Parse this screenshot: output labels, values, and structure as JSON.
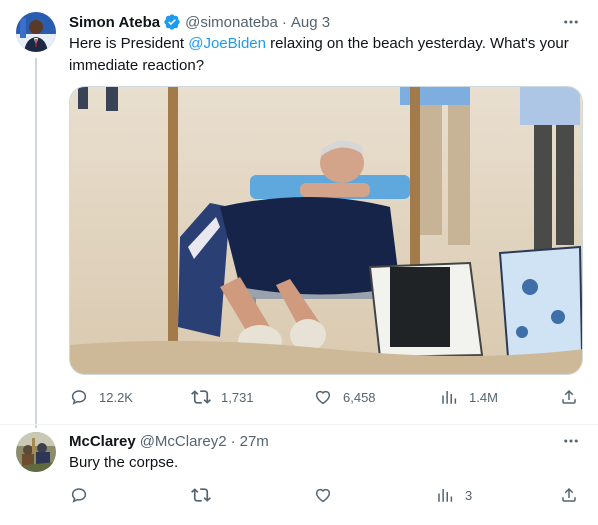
{
  "colors": {
    "accent": "#1d9bf0",
    "text": "#0f1419",
    "muted": "#536471",
    "thread_line": "#cfd9de"
  },
  "main_tweet": {
    "author_name": "Simon Ateba",
    "verified": true,
    "handle": "@simonateba",
    "separator": "·",
    "time": "Aug 3",
    "text_before_mention": "Here is President ",
    "mention": "@JoeBiden",
    "text_after_mention": " relaxing on the beach yesterday. What's your immediate reaction?",
    "has_media": true,
    "actions": {
      "reply_icon": "reply-icon",
      "reply_count": "12.2K",
      "retweet_icon": "retweet-icon",
      "retweet_count": "1,731",
      "like_icon": "like-icon",
      "like_count": "6,458",
      "views_icon": "views-icon",
      "views_count": "1.4M",
      "share_icon": "share-icon"
    }
  },
  "reply_tweet": {
    "author_name": "McClarey",
    "handle": "@McClarey2",
    "separator": "·",
    "time": "27m",
    "text": "Bury the corpse.",
    "actions": {
      "reply_icon": "reply-icon",
      "retweet_icon": "retweet-icon",
      "like_icon": "like-icon",
      "views_icon": "views-icon",
      "views_count": "3",
      "share_icon": "share-icon"
    }
  }
}
